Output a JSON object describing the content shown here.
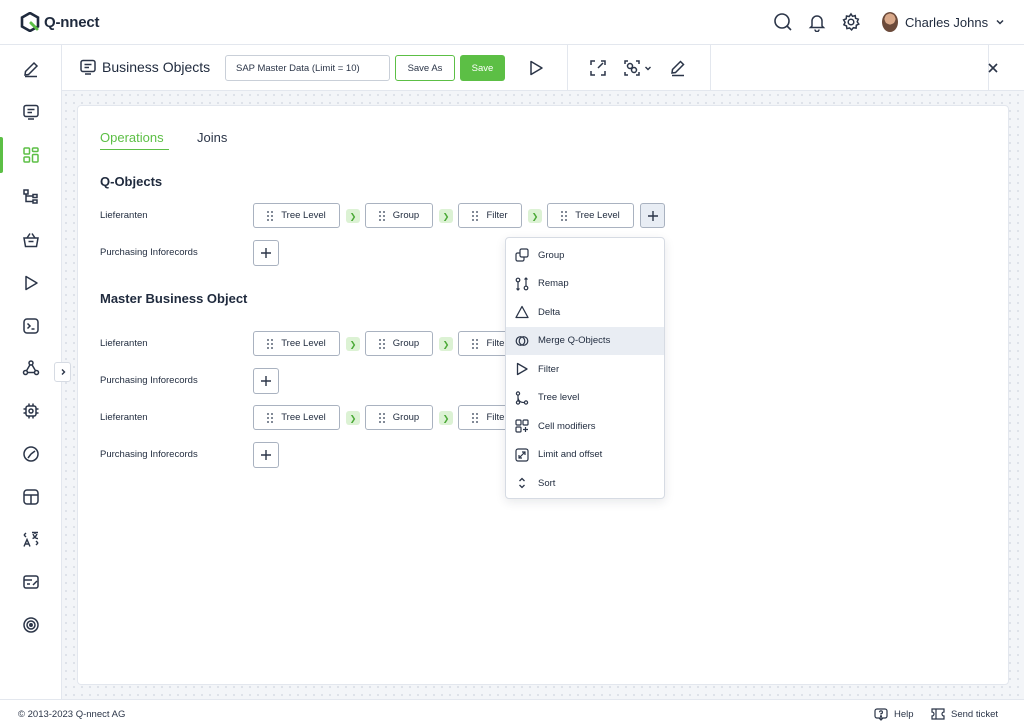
{
  "app": {
    "brand": "Q-nnect"
  },
  "header": {
    "user_name": "Charles Johns"
  },
  "toolbar": {
    "title": "Business Objects",
    "object_name": "SAP Master Data (Limit = 10)",
    "save_as_label": "Save As",
    "save_label": "Save"
  },
  "tabs": [
    {
      "label": "Operations",
      "active": true
    },
    {
      "label": "Joins",
      "active": false
    }
  ],
  "qobjects": {
    "title": "Q-Objects",
    "rows": [
      {
        "label": "Lieferanten",
        "ops": [
          "Tree Level",
          "Group",
          "Filter",
          "Tree Level"
        ]
      },
      {
        "label": "Purchasing Inforecords",
        "ops": []
      }
    ]
  },
  "master": {
    "title": "Master Business Object",
    "rows": [
      {
        "label": "Lieferanten",
        "ops": [
          "Tree Level",
          "Group",
          "Filter"
        ]
      },
      {
        "label": "Purchasing Inforecords",
        "ops": []
      },
      {
        "label": "Lieferanten",
        "ops": [
          "Tree Level",
          "Group",
          "Filter"
        ]
      },
      {
        "label": "Purchasing Inforecords",
        "ops": []
      }
    ]
  },
  "dropdown": {
    "items": [
      {
        "label": "Group",
        "icon": "group-icon"
      },
      {
        "label": "Remap",
        "icon": "remap-icon"
      },
      {
        "label": "Delta",
        "icon": "delta-icon"
      },
      {
        "label": "Merge Q-Objects",
        "icon": "merge-icon",
        "hovered": true
      },
      {
        "label": "Filter",
        "icon": "filter-icon"
      },
      {
        "label": "Tree level",
        "icon": "tree-level-icon"
      },
      {
        "label": "Cell modifiers",
        "icon": "cell-modifiers-icon"
      },
      {
        "label": "Limit and offset",
        "icon": "limit-offset-icon"
      },
      {
        "label": "Sort",
        "icon": "sort-icon"
      }
    ]
  },
  "footer": {
    "copyright": "© 2013-2023 Q-nnect AG",
    "help_label": "Help",
    "ticket_label": "Send ticket"
  },
  "colors": {
    "accent": "#5cbf45",
    "text": "#1f2a3d",
    "border": "#a9b2c0"
  }
}
